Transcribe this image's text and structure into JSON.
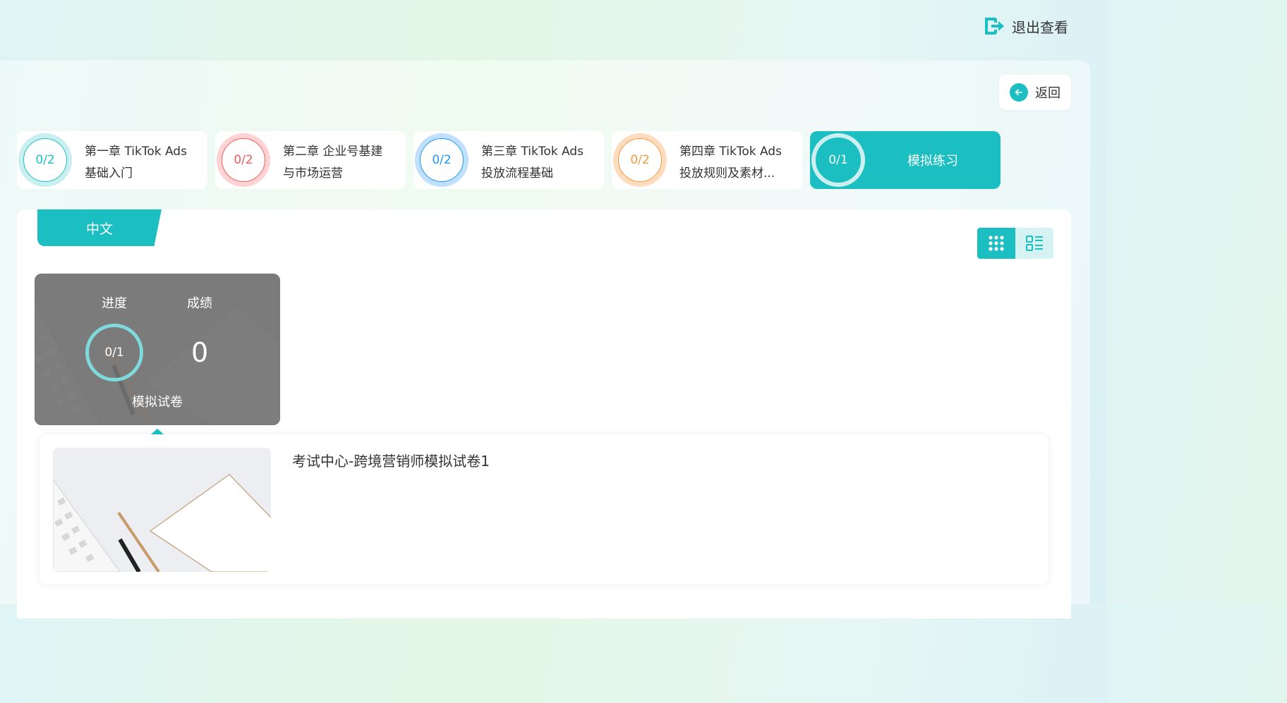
{
  "header": {
    "exit_label": "退出查看"
  },
  "nav": {
    "back_label": "返回"
  },
  "chapters": [
    {
      "progress": "0/2",
      "title_line1": "第一章 TikTok Ads",
      "title_line2": "基础入门",
      "color": "#1bbfc2",
      "ring": "#c9eff0"
    },
    {
      "progress": "0/2",
      "title_line1": "第二章 企业号基建",
      "title_line2": "与市场运营",
      "color": "#f05a5a",
      "ring": "#ffd3d3"
    },
    {
      "progress": "0/2",
      "title_line1": "第三章 TikTok Ads",
      "title_line2": "投放流程基础",
      "color": "#2196f3",
      "ring": "#bfe0ff"
    },
    {
      "progress": "0/2",
      "title_line1": "第四章 TikTok Ads",
      "title_line2": "投放规则及素材...",
      "color": "#f39a3a",
      "ring": "#ffdcbd"
    }
  ],
  "active_chapter": {
    "progress": "0/1",
    "title": "模拟练习"
  },
  "language_tab": "中文",
  "exam_card": {
    "progress_label": "进度",
    "score_label": "成绩",
    "progress_value": "0/1",
    "score_value": "0",
    "title": "模拟试卷"
  },
  "exam_detail": {
    "name": "考试中心-跨境营销师模拟试卷1"
  },
  "colors": {
    "accent": "#1bbfc2"
  }
}
